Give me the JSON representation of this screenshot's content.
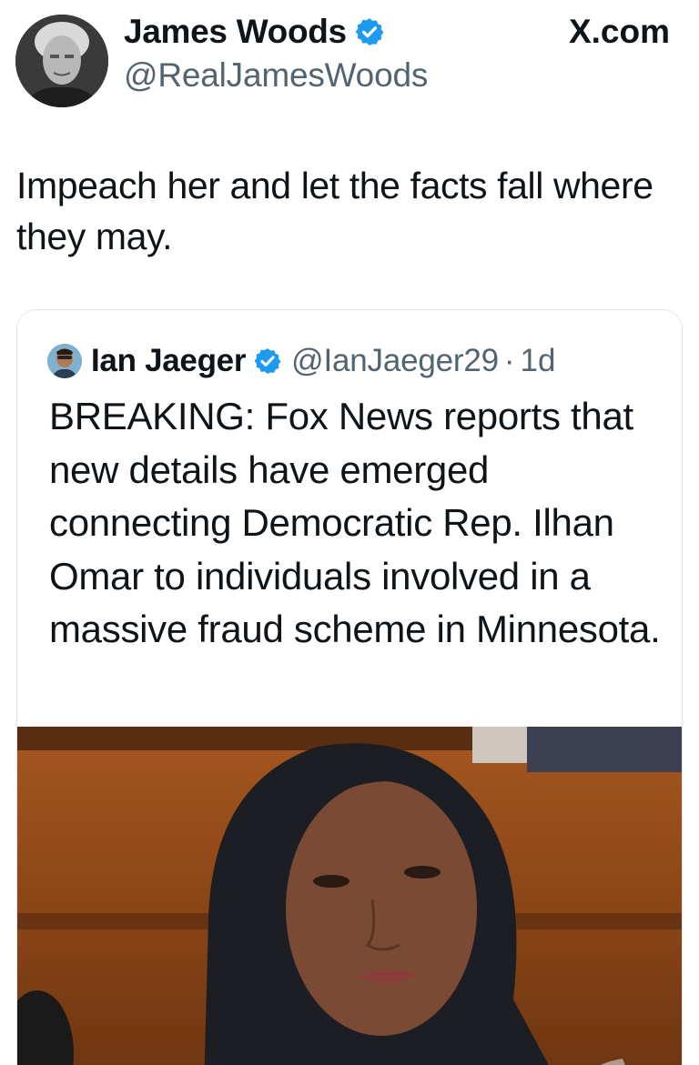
{
  "author": {
    "name": "James Woods",
    "handle": "@RealJamesWoods",
    "verified": true
  },
  "site_label": "X.com",
  "tweet": {
    "text": "Impeach her and let the facts fall where they may."
  },
  "quoted_tweet": {
    "name": "Ian Jaeger",
    "handle": "@IanJaeger29",
    "separator": "·",
    "time": "1d",
    "verified": true,
    "text": "BREAKING: Fox News reports that new details have emerged connecting Democratic Rep. Ilhan Omar to individuals involved in a massive fraud scheme in Minnesota."
  },
  "icons": {
    "verified": "verified-badge-icon"
  },
  "colors": {
    "text_primary": "#0f1419",
    "text_secondary": "#536471",
    "verified_blue": "#1d9bf0",
    "card_border": "#e2e6ea"
  }
}
